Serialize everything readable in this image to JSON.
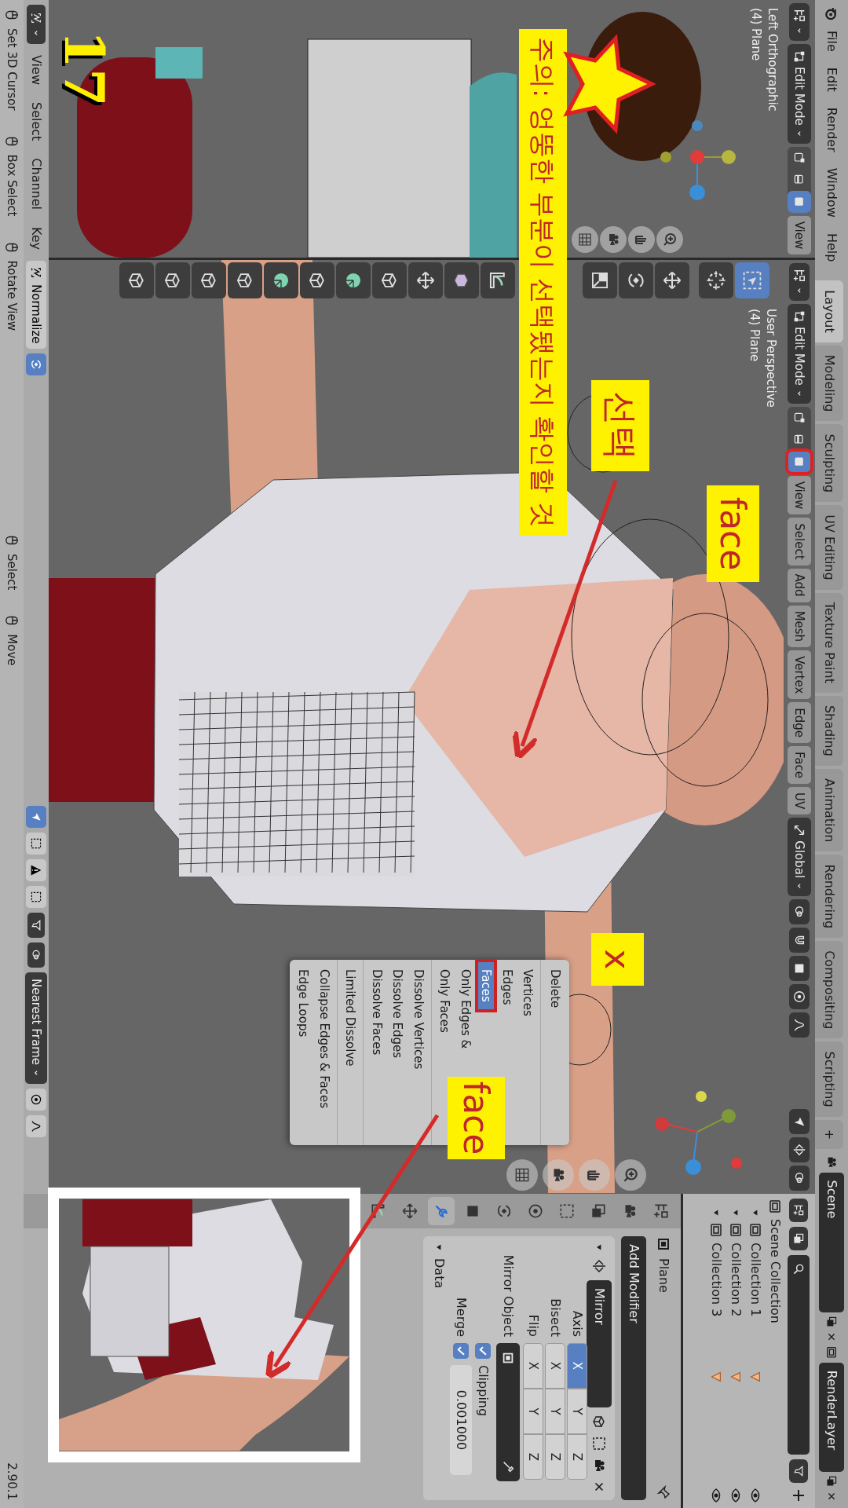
{
  "top_bar": {
    "menus": [
      "File",
      "Edit",
      "Render",
      "Window",
      "Help"
    ],
    "workspaces": [
      {
        "label": "Layout",
        "selected": true
      },
      {
        "label": "Modeling",
        "selected": false
      },
      {
        "label": "Sculpting",
        "selected": false
      },
      {
        "label": "UV Editing",
        "selected": false
      },
      {
        "label": "Texture Paint",
        "selected": false
      },
      {
        "label": "Shading",
        "selected": false
      },
      {
        "label": "Animation",
        "selected": false
      },
      {
        "label": "Rendering",
        "selected": false
      },
      {
        "label": "Compositing",
        "selected": false
      },
      {
        "label": "Scripting",
        "selected": false
      }
    ],
    "add_tab": "+",
    "scene": "Scene",
    "view_layer": "RenderLayer"
  },
  "left_viewport": {
    "mode": "Edit Mode",
    "select_modes": [
      {
        "kind": "vertex",
        "selected": false,
        "highlighted": false
      },
      {
        "kind": "edge",
        "selected": false,
        "highlighted": false
      },
      {
        "kind": "face",
        "selected": true,
        "highlighted": false
      }
    ],
    "menus": [
      "View"
    ],
    "view_name": "Left Orthographic",
    "object": "(4) Plane"
  },
  "main_viewport": {
    "mode": "Edit Mode",
    "select_modes": [
      {
        "kind": "vertex",
        "selected": false,
        "highlighted": false
      },
      {
        "kind": "edge",
        "selected": false,
        "highlighted": false
      },
      {
        "kind": "face",
        "selected": true,
        "highlighted": true
      }
    ],
    "menus": [
      "View",
      "Select",
      "Add",
      "Mesh",
      "Vertex",
      "Edge",
      "Face",
      "UV"
    ],
    "orientation": "Global",
    "view_name": "User Perspective",
    "object": "(4) Plane"
  },
  "delete_menu": {
    "title": "Delete",
    "groups": [
      [
        {
          "label": "Vertices",
          "selected": false,
          "highlighted": false
        },
        {
          "label": "Edges",
          "selected": false,
          "highlighted": false
        },
        {
          "label": "Faces",
          "selected": true,
          "highlighted": true
        },
        {
          "label": "Only Edges &",
          "selected": false,
          "highlighted": false
        },
        {
          "label": "Only Faces",
          "selected": false,
          "highlighted": false
        }
      ],
      [
        {
          "label": "Dissolve Vertices",
          "selected": false,
          "highlighted": false
        },
        {
          "label": "Dissolve Edges",
          "selected": false,
          "highlighted": false
        },
        {
          "label": "Dissolve Faces",
          "selected": false,
          "highlighted": false
        }
      ],
      [
        {
          "label": "Limited Dissolve",
          "selected": false,
          "highlighted": false
        }
      ],
      [
        {
          "label": "Collapse Edges & Faces",
          "selected": false,
          "highlighted": false
        },
        {
          "label": "Edge Loops",
          "selected": false,
          "highlighted": false
        }
      ]
    ]
  },
  "outliner": {
    "root": "Scene Collection",
    "children": [
      {
        "label": "Collection 1"
      },
      {
        "label": "Collection 2"
      },
      {
        "label": "Collection 3"
      }
    ]
  },
  "properties": {
    "object": "Plane",
    "add_modifier": "Add Modifier",
    "modifier": {
      "name": "Mirror",
      "rows": [
        {
          "label": "Axis",
          "toggles": [
            {
              "label": "X",
              "on": true
            },
            {
              "label": "Y",
              "on": false
            },
            {
              "label": "Z",
              "on": false
            }
          ]
        },
        {
          "label": "Bisect",
          "toggles": [
            {
              "label": "X",
              "on": false
            },
            {
              "label": "Y",
              "on": false
            },
            {
              "label": "Z",
              "on": false
            }
          ]
        },
        {
          "label": "Flip",
          "toggles": [
            {
              "label": "X",
              "on": false
            },
            {
              "label": "Y",
              "on": false
            },
            {
              "label": "Z",
              "on": false
            }
          ]
        }
      ],
      "mirror_object": "Mirror Object",
      "clipping": {
        "label": "Clipping",
        "checked": true
      },
      "merge": {
        "label": "Merge",
        "checked": true,
        "value": "0.001000"
      },
      "subpanel": "Data"
    }
  },
  "timeline": {
    "menus": [
      "View",
      "Select",
      "Channel",
      "Key"
    ],
    "normalize": "Normalize",
    "frame_mode": "Nearest Frame"
  },
  "status_bar": {
    "hints": [
      "Set 3D Cursor",
      "Box Select",
      "Rotate View",
      "Select",
      "Move"
    ],
    "version": "2.90.1"
  },
  "annotations": [
    {
      "kind": "step",
      "text": "17"
    },
    {
      "kind": "note",
      "text": "주의: 엉뚱한 부분이 선택됐는지 확인할 것"
    },
    {
      "kind": "label",
      "text": "선택"
    },
    {
      "kind": "label",
      "text": "face"
    },
    {
      "kind": "label",
      "text": "x"
    },
    {
      "kind": "label",
      "text": "face"
    }
  ]
}
